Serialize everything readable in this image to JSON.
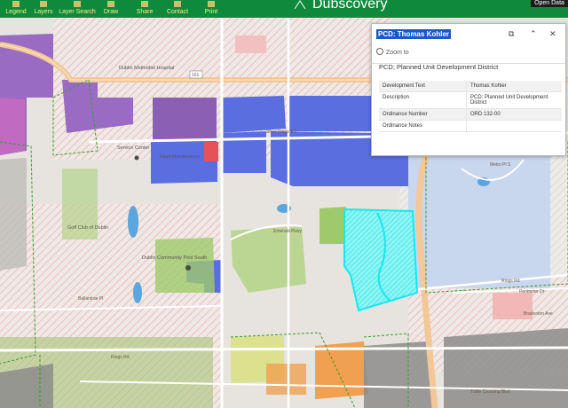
{
  "toolbar": {
    "tools": [
      {
        "label": "Legend",
        "icon": "legend-icon"
      },
      {
        "label": "Layers",
        "icon": "layers-icon"
      },
      {
        "label": "Layer Search",
        "icon": "search-icon"
      },
      {
        "label": "Draw",
        "icon": "draw-icon"
      },
      {
        "label": "Share",
        "icon": "share-icon"
      },
      {
        "label": "Contact",
        "icon": "contact-icon"
      },
      {
        "label": "Print",
        "icon": "print-icon"
      }
    ],
    "app_title": "Dubscovery",
    "open_button": "Open Data"
  },
  "popup": {
    "title": "PCD: Thomas Kohler",
    "zoom_to": "Zoom to",
    "heading": "PCD; Planned Unit Development District",
    "attributes": [
      {
        "field": "Development Text",
        "value": "Thomas Kohler"
      },
      {
        "field": "Description",
        "value": "PCD: Planned Unit Development District"
      },
      {
        "field": "Ordinance Number",
        "value": "ORD 132-00"
      },
      {
        "field": "Ordinance Notes",
        "value": ""
      }
    ]
  },
  "map": {
    "place_labels": {
      "hospital": "Dublin Methodist Hospital",
      "service_center": "Service Center",
      "fleet_maintenance": "Fleet Maintenance",
      "community_pool": "Dublin Community Pool South",
      "golf_club": "Golf Club of Dublin"
    },
    "road_labels": {
      "rings_rd": "Rings Rd",
      "perimeter_dr": "Perimeter Dr",
      "bradenton_ave": "Bradenton Ave",
      "metro_pl": "Metro Pl S",
      "emerald_pkwy": "Emerald Pkwy",
      "coffman_rd": "Coffman Rd",
      "avery_rd": "Avery Rd",
      "shier_rings_rd": "Shier Rings Rd",
      "ballantrae_pl": "Ballantrae Pl",
      "churchman_rd": "Churchman Rd",
      "frantz_rd": "Frantz Rd",
      "tuttle_crossing": "Tuttle Crossing Blvd",
      "blazer_pkwy": "Blazer Pkwy",
      "wilcox_rd": "Wilcox Rd",
      "innovation_dr": "Innovation Dr"
    },
    "highway_shield": "161",
    "colors": {
      "selection": "#17e8ee",
      "planned_dev": "#5a6ee0",
      "industrial": "#9a6bc2",
      "park": "#9fca6a",
      "water": "#5ba6de",
      "zoning_outline": "#3a9a2a",
      "toolbar": "#0f8a3c"
    }
  }
}
